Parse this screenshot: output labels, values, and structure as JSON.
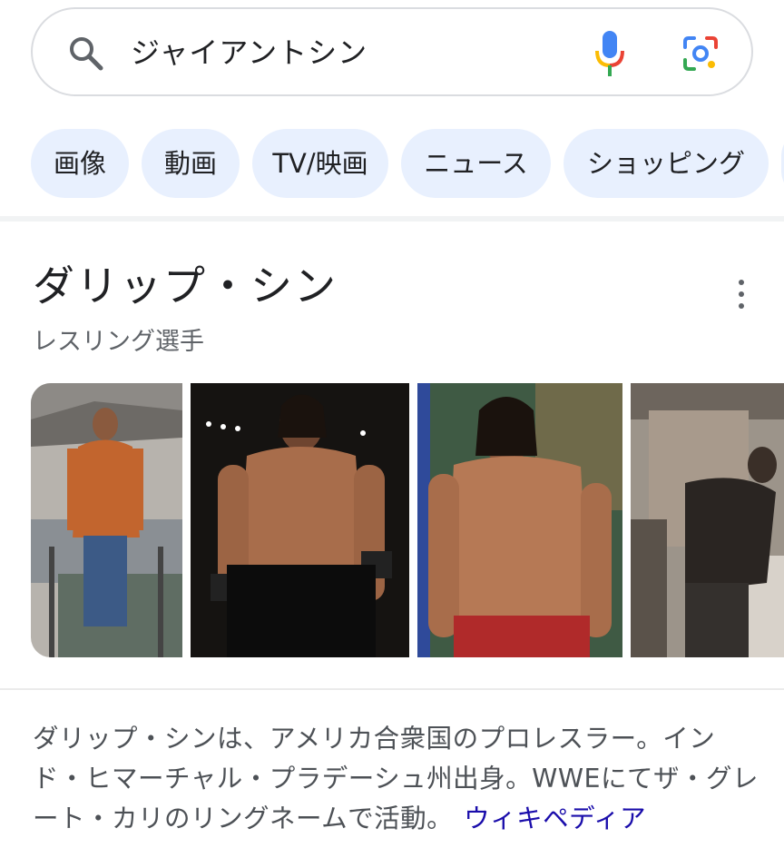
{
  "search": {
    "query": "ジャイアントシン"
  },
  "chips": [
    {
      "label": "画像"
    },
    {
      "label": "動画"
    },
    {
      "label": "TV/映画"
    },
    {
      "label": "ニュース"
    },
    {
      "label": "ショッピング"
    }
  ],
  "knowledge_panel": {
    "title": "ダリップ・シン",
    "subtitle": "レスリング選手",
    "description": "ダリップ・シンは、アメリカ合衆国のプロレスラー。インド・ヒマーチャル・プラデーシュ州出身。WWEにてザ・グレート・カリのリングネームで活動。",
    "source_link": "ウィキペディア"
  },
  "images": [
    {
      "name": "wrestler-orange-shirt-image"
    },
    {
      "name": "wrestler-black-trunks-image"
    },
    {
      "name": "wrestler-red-trunks-image"
    },
    {
      "name": "movie-scene-image"
    }
  ],
  "colors": {
    "chip_bg": "#e8f0fe",
    "link": "#1a0dab",
    "mic_blue": "#4285f4",
    "mic_green": "#34a853",
    "mic_yellow": "#fbbc04",
    "mic_red": "#ea4335"
  },
  "icons": [
    "search-icon",
    "mic-icon",
    "lens-icon",
    "more-vert-icon"
  ]
}
